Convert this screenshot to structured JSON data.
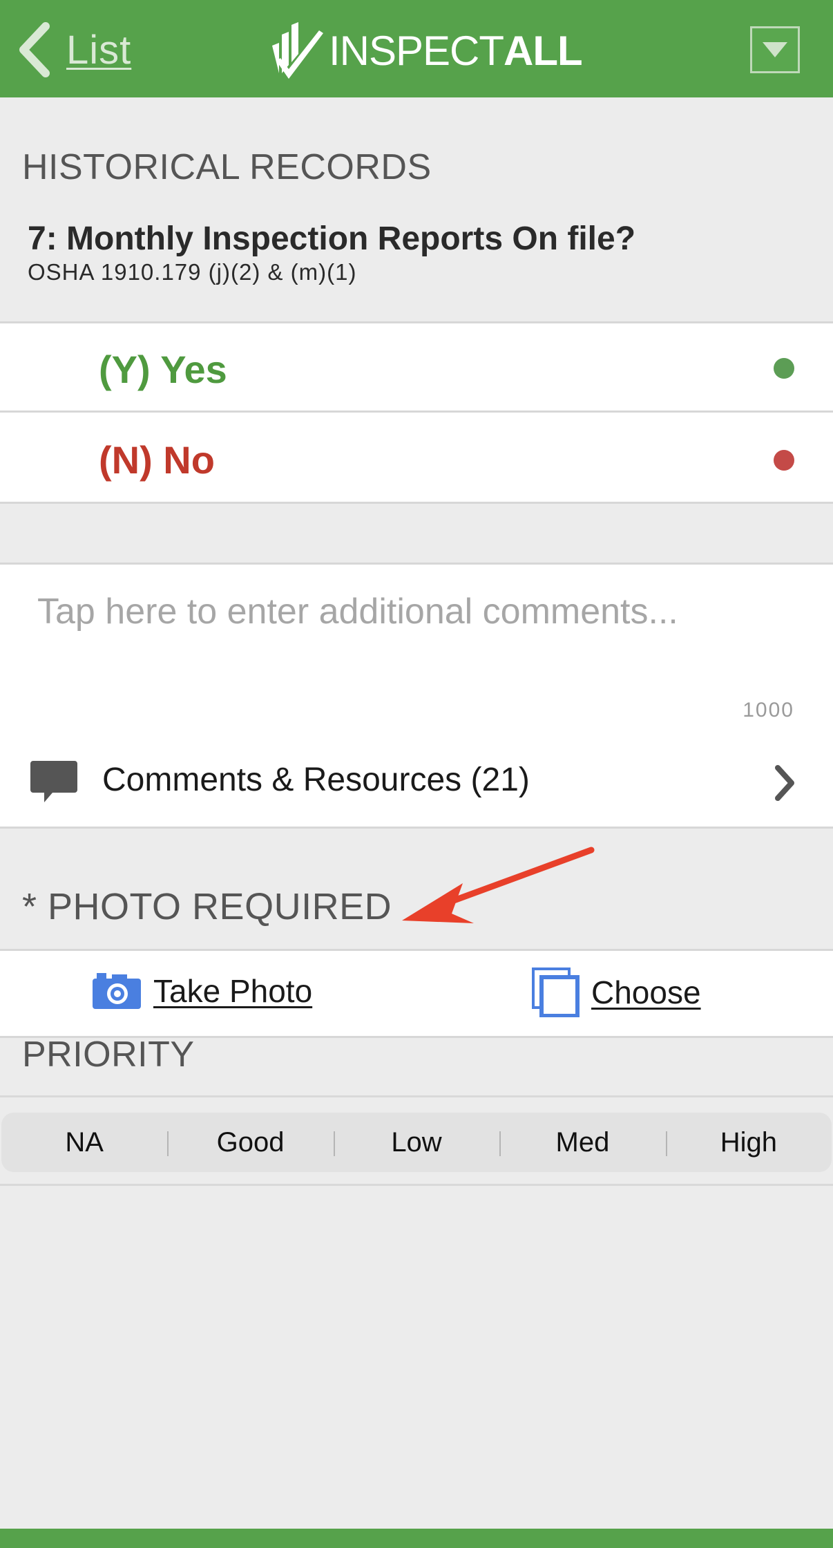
{
  "header": {
    "back_label": "List",
    "logo_text_light": "INSPECT",
    "logo_text_bold": "ALL"
  },
  "section": {
    "title": "HISTORICAL RECORDS",
    "question_title": "7: Monthly Inspection Reports On file?",
    "question_ref": "OSHA 1910.179 (j)(2) & (m)(1)"
  },
  "answers": [
    {
      "label": "(Y) Yes",
      "color": "#4f9a3f",
      "dot_color": "#5c9d55"
    },
    {
      "label": "(N) No",
      "color": "#c0392b",
      "dot_color": "#c44a47"
    }
  ],
  "comments": {
    "placeholder": "Tap here to enter additional comments...",
    "counter": "1000"
  },
  "resources": {
    "label": "Comments & Resources (21)"
  },
  "photo": {
    "required_label": "* PHOTO REQUIRED",
    "take_label": "Take Photo",
    "choose_label": "Choose"
  },
  "priority": {
    "title": "PRIORITY",
    "options": [
      "NA",
      "Good",
      "Low",
      "Med",
      "High"
    ]
  },
  "colors": {
    "brand_green": "#56a24b",
    "icon_blue": "#4a7fe0",
    "annotation_red": "#e8402a"
  }
}
